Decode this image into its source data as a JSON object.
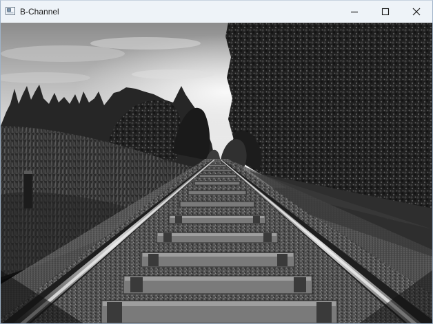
{
  "window": {
    "title": "B-Channel",
    "app_icon": "opencv-window-icon"
  },
  "controls": {
    "minimize_icon": "minimize-icon",
    "maximize_icon": "maximize-icon",
    "close_icon": "close-icon"
  },
  "image": {
    "description_icon": "grayscale-photo",
    "channel": "B"
  }
}
